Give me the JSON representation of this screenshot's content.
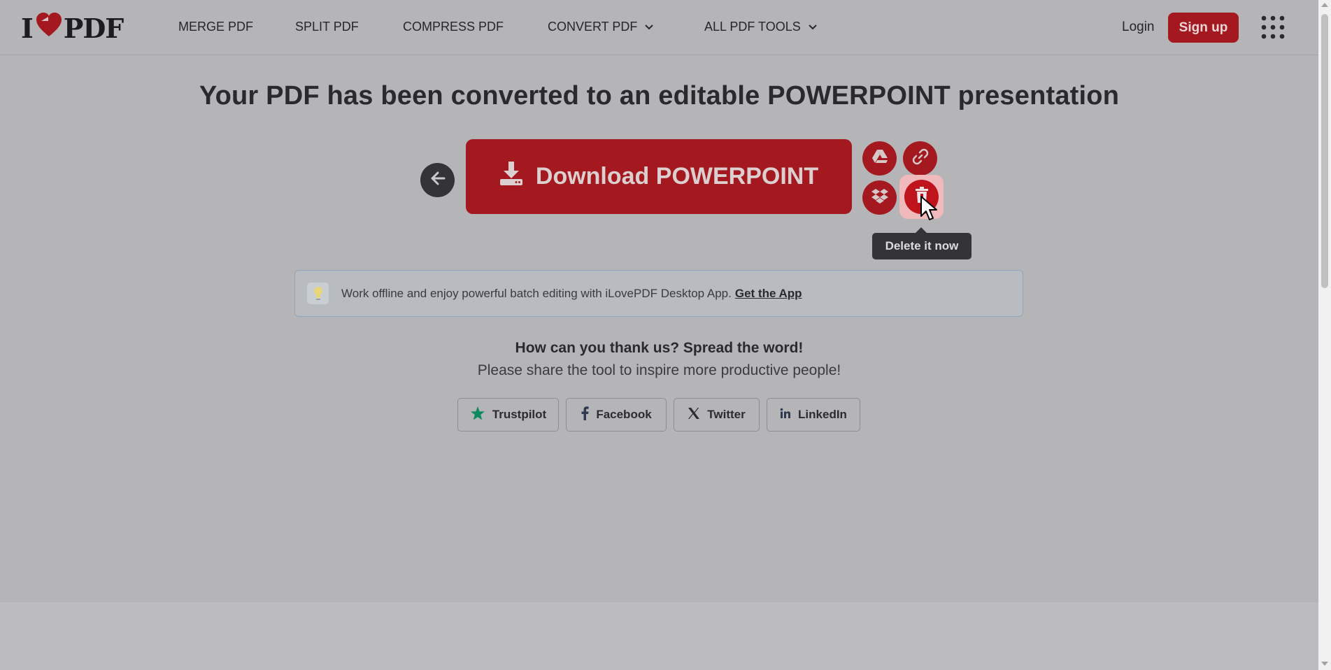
{
  "header": {
    "logo": {
      "prefix": "I",
      "suffix": "PDF"
    },
    "nav": [
      {
        "label": "MERGE PDF"
      },
      {
        "label": "SPLIT PDF"
      },
      {
        "label": "COMPRESS PDF"
      },
      {
        "label": "CONVERT PDF"
      },
      {
        "label": "ALL PDF TOOLS"
      }
    ],
    "login_label": "Login",
    "signup_label": "Sign up"
  },
  "main": {
    "title": "Your PDF has been converted to an editable POWERPOINT presentation",
    "download_label": "Download POWERPOINT",
    "tooltip": "Delete it now",
    "promo": {
      "text": "Work offline and enjoy powerful batch editing with iLovePDF Desktop App.",
      "link": "Get the App"
    },
    "share": {
      "heading": "How can you thank us? Spread the word!",
      "subheading": "Please share the tool to inspire more productive people!",
      "buttons": [
        {
          "label": "Trustpilot",
          "icon": "star-icon"
        },
        {
          "label": "Facebook",
          "icon": "facebook-icon"
        },
        {
          "label": "Twitter",
          "icon": "x-icon"
        },
        {
          "label": "LinkedIn",
          "icon": "linkedin-icon"
        }
      ]
    }
  },
  "colors": {
    "brand_red": "#a4191f",
    "overlay_gray": "#b5b5b7",
    "dark": "#333338"
  }
}
